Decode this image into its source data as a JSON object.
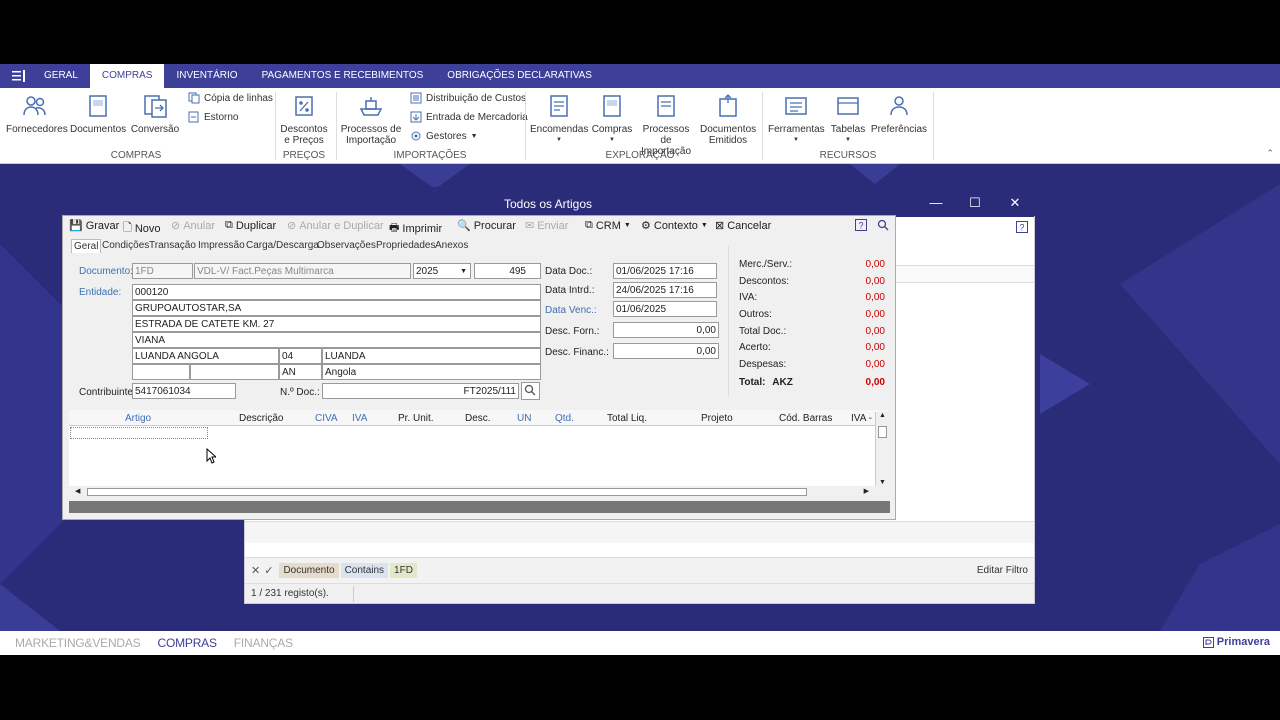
{
  "ribbon_tabs": [
    "GERAL",
    "COMPRAS",
    "INVENTÁRIO",
    "PAGAMENTOS E RECEBIMENTOS",
    "OBRIGAÇÕES DECLARATIVAS"
  ],
  "ribbon": {
    "fornecedores": "Fornecedores",
    "documentos": "Documentos",
    "conversao": "Conversão",
    "copia_linhas": "Cópia de linhas",
    "estorno": "Estorno",
    "descontos": "Descontos",
    "e_precos": "e Preços",
    "processos1": "Processos de",
    "importacao1": "Importação",
    "distribuicao": "Distribuição de Custos",
    "entrada": "Entrada de Mercadoria",
    "gestores": "Gestores",
    "encomendas": "Encomendas",
    "compras": "Compras",
    "processos2": "Processos de",
    "importacao2": "Importação",
    "doc_emit1": "Documentos",
    "doc_emit2": "Emitidos",
    "ferramentas": "Ferramentas",
    "tabelas": "Tabelas",
    "preferencias": "Preferências",
    "groups": {
      "compras": "COMPRAS",
      "precos": "PREÇOS",
      "importacoes": "IMPORTAÇÕES",
      "exploracao": "EXPLORAÇÃO",
      "recursos": "RECURSOS"
    }
  },
  "dialog": {
    "title": "Todos os Artigos",
    "toolbar": {
      "gravar": "Gravar",
      "novo": "Novo",
      "anular": "Anular",
      "duplicar": "Duplicar",
      "anular_duplicar": "Anular e Duplicar",
      "imprimir": "Imprimir",
      "procurar": "Procurar",
      "enviar": "Enviar",
      "crm": "CRM",
      "contexto": "Contexto",
      "cancelar": "Cancelar"
    },
    "tabs": [
      "Geral",
      "Condições",
      "Transação",
      "Impressão",
      "Carga/Descarga",
      "Observações",
      "Propriedades",
      "Anexos"
    ],
    "form": {
      "documento_label": "Documento:",
      "documento": "1FD",
      "documento_desc": "VDL-V/ Fact.Peças Multimarca",
      "ano": "2025",
      "numero": "495",
      "entidade_label": "Entidade:",
      "entidade": "000120",
      "nome": "GRUPOAUTOSTAR,SA",
      "morada": "ESTRADA DE CATETE KM. 27",
      "localidade": "VIANA",
      "cidade": "LUANDA ANGOLA",
      "distrito_cod": "04",
      "distrito": "LUANDA",
      "pais_cod": "AN",
      "pais": "Angola",
      "contribuinte_label": "Contribuinte:",
      "contribuinte": "5417061034",
      "ndoc_label": "N.º Doc.:",
      "ndoc": "FT2025/111",
      "data_doc_label": "Data Doc.:",
      "data_doc": "01/06/2025 17:16",
      "data_intrd_label": "Data Intrd.:",
      "data_intrd": "24/06/2025 17:16",
      "data_venc_label": "Data Venc.:",
      "data_venc": "01/06/2025",
      "desc_forn_label": "Desc. Forn.:",
      "desc_forn": "0,00",
      "desc_financ_label": "Desc. Financ.:",
      "desc_financ": "0,00"
    },
    "totals": [
      {
        "label": "Merc./Serv.:",
        "value": "0,00"
      },
      {
        "label": "Descontos:",
        "value": "0,00"
      },
      {
        "label": "IVA:",
        "value": "0,00"
      },
      {
        "label": "Outros:",
        "value": "0,00"
      },
      {
        "label": "Total Doc.:",
        "value": "0,00"
      },
      {
        "label": "Acerto:",
        "value": "0,00"
      },
      {
        "label": "Despesas:",
        "value": "0,00"
      }
    ],
    "total_label": "Total:",
    "total_currency": "AKZ",
    "total_value": "0,00",
    "grid_columns": [
      "Artigo",
      "Descrição",
      "CIVA",
      "IVA",
      "Pr. Unit.",
      "Desc.",
      "UN",
      "Qtd.",
      "Total Liq.",
      "Projeto",
      "Cód. Barras",
      "IVA - F"
    ]
  },
  "list": {
    "filter_chips": [
      "Documento",
      "Contains",
      "1FD"
    ],
    "edit_filter": "Editar Filtro",
    "records": "1 / 231 registo(s)."
  },
  "bottom_nav": [
    "MARKETING&VENDAS",
    "COMPRAS",
    "FINANÇAS"
  ],
  "brand": "Primavera"
}
